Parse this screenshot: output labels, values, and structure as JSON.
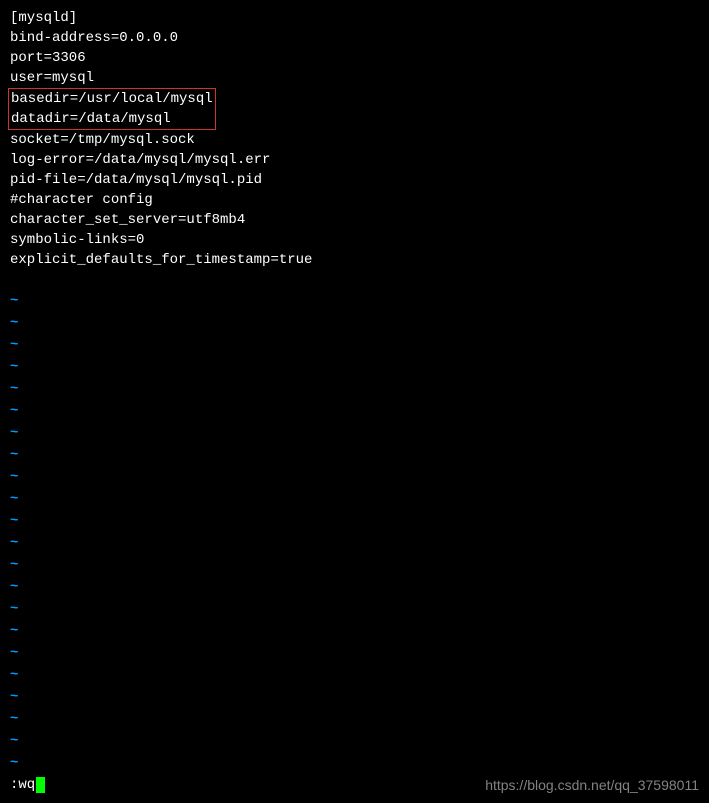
{
  "config": {
    "section_header": "[mysqld]",
    "lines": [
      "bind-address=0.0.0.0",
      "port=3306",
      "user=mysql"
    ],
    "highlighted": [
      "basedir=/usr/local/mysql",
      "datadir=/data/mysql"
    ],
    "lines_after": [
      "socket=/tmp/mysql.sock",
      "log-error=/data/mysql/mysql.err",
      "pid-file=/data/mysql/mysql.pid",
      "#character config",
      "character_set_server=utf8mb4",
      "symbolic-links=0",
      "explicit_defaults_for_timestamp=true"
    ]
  },
  "tilde_char": "~",
  "tilde_count": 22,
  "command": ":wq",
  "watermark": "https://blog.csdn.net/qq_37598011"
}
